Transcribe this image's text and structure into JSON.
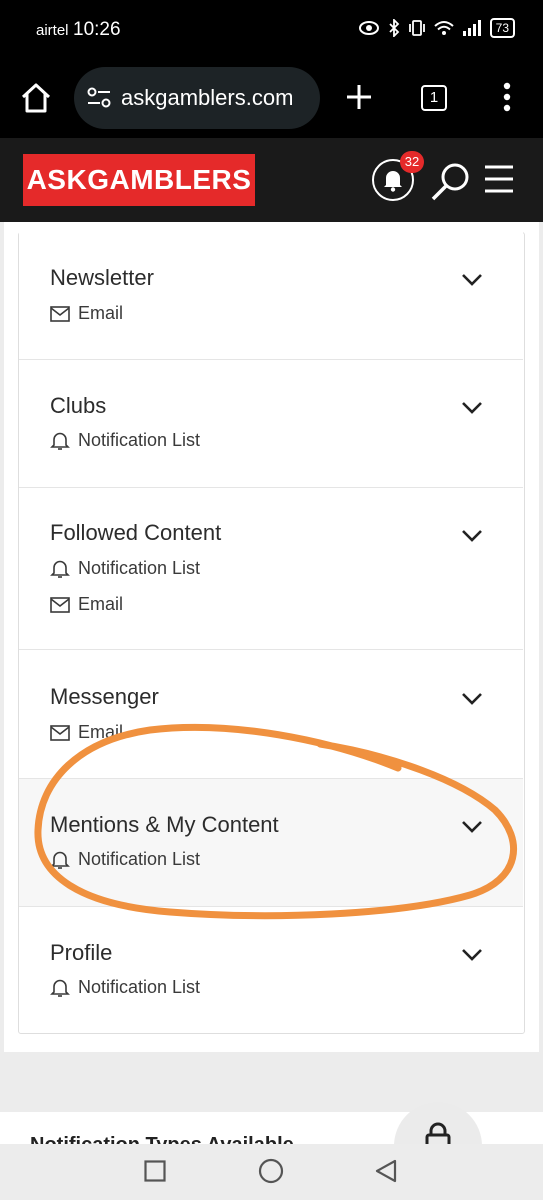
{
  "status": {
    "carrier": "airtel",
    "time": "10:26",
    "battery": "73"
  },
  "browser": {
    "url": "askgamblers.com",
    "tab_count": "1"
  },
  "site": {
    "logo_text": "ASKGAMBLERS",
    "notification_count": "32"
  },
  "sections": [
    {
      "title": "Newsletter",
      "lines": [
        {
          "icon": "mail-icon",
          "label": "Email"
        }
      ]
    },
    {
      "title": "Clubs",
      "lines": [
        {
          "icon": "bell-icon",
          "label": "Notification List"
        }
      ]
    },
    {
      "title": "Followed Content",
      "lines": [
        {
          "icon": "bell-icon",
          "label": "Notification List"
        },
        {
          "icon": "mail-icon",
          "label": "Email"
        }
      ]
    },
    {
      "title": "Messenger",
      "lines": [
        {
          "icon": "mail-icon",
          "label": "Email"
        }
      ]
    },
    {
      "title": "Mentions & My Content",
      "lines": [
        {
          "icon": "bell-icon",
          "label": "Notification List"
        }
      ]
    },
    {
      "title": "Profile",
      "lines": [
        {
          "icon": "bell-icon",
          "label": "Notification List"
        }
      ]
    }
  ],
  "lower_panel": {
    "heading": "Notification Types Available"
  },
  "colors": {
    "brand_red": "#e52a2a",
    "annotation_orange": "#f0913f",
    "header_dark": "#1a1a1a"
  }
}
